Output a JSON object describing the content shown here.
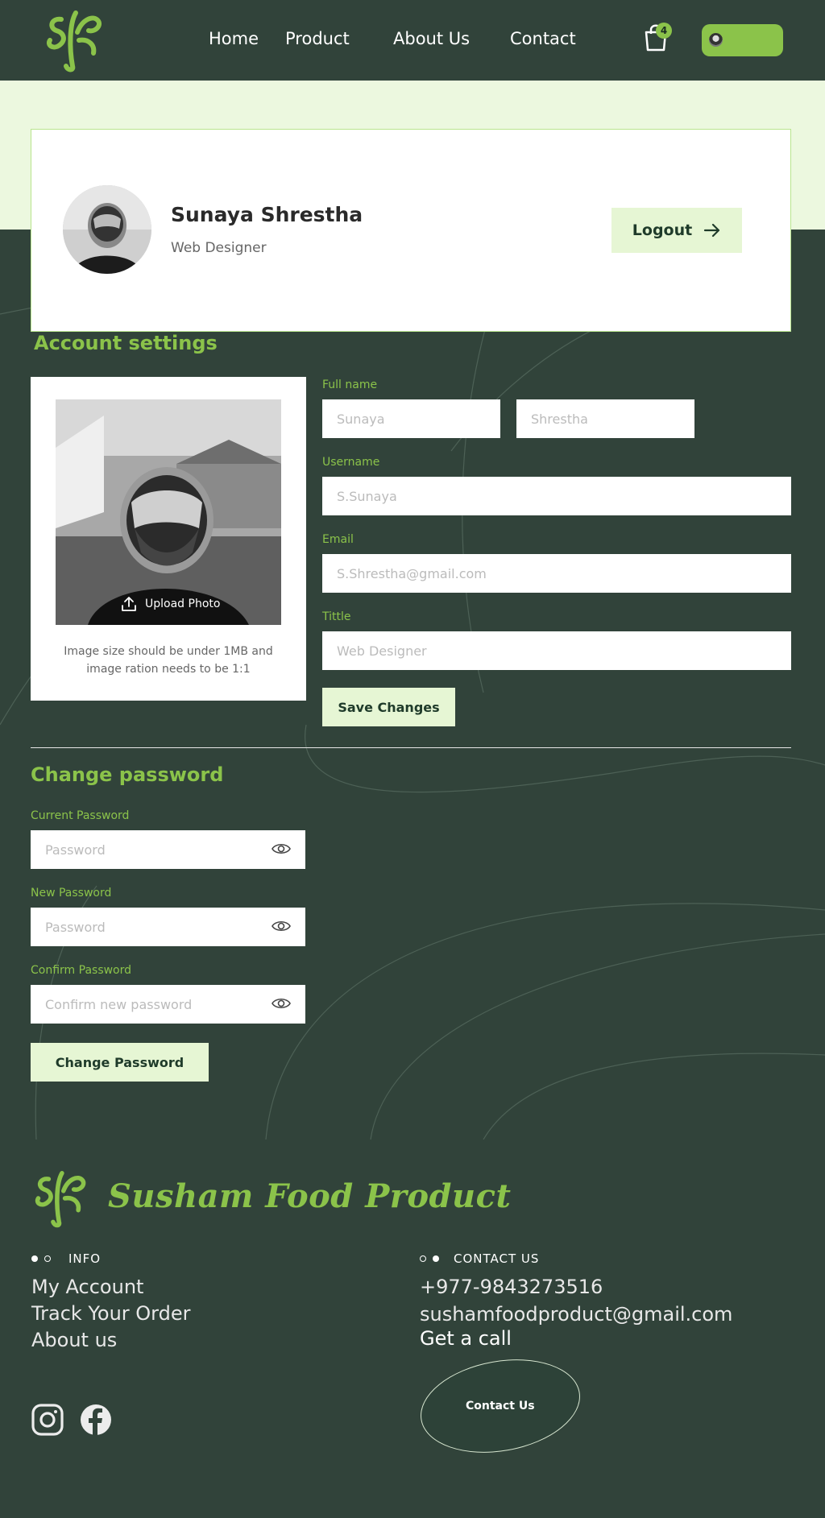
{
  "nav": {
    "links": [
      "Home",
      "Product",
      "About Us",
      "Contact"
    ],
    "cart_count": "4"
  },
  "profile": {
    "name": "Sunaya Shrestha",
    "role": "Web Designer",
    "logout_label": "Logout"
  },
  "account": {
    "title": "Account settings",
    "upload_label": "Upload Photo",
    "photo_note": "Image size should be under 1MB and image ration needs to be 1:1",
    "fullname_label": "Full name",
    "first_name": "Sunaya",
    "last_name": "Shrestha",
    "username_label": "Username",
    "username": "S.Sunaya",
    "email_label": "Email",
    "email": "S.Shrestha@gmail.com",
    "title_label": "Tittle",
    "title_value": "Web Designer",
    "save_label": "Save Changes"
  },
  "password": {
    "title": "Change password",
    "current_label": "Current Password",
    "current_placeholder": "Password",
    "new_label": "New Password",
    "new_placeholder": "Password",
    "confirm_label": "Confirm Password",
    "confirm_placeholder": "Confirm new password",
    "button_label": "Change Password"
  },
  "footer": {
    "brand": "Susham Food Product",
    "info_heading": "INFO",
    "info_links": [
      "My Account",
      "Track Your Order",
      "About us"
    ],
    "contact_heading": "CONTACT US",
    "phone": "+977-9843273516",
    "email": "sushamfoodproduct@gmail.com",
    "call_text": "Get a call",
    "contact_button": "Contact Us"
  },
  "colors": {
    "background": "#31433a",
    "accent": "#8bc34a",
    "light_band": "#ecf8df",
    "button_light": "#e6f6d4"
  }
}
